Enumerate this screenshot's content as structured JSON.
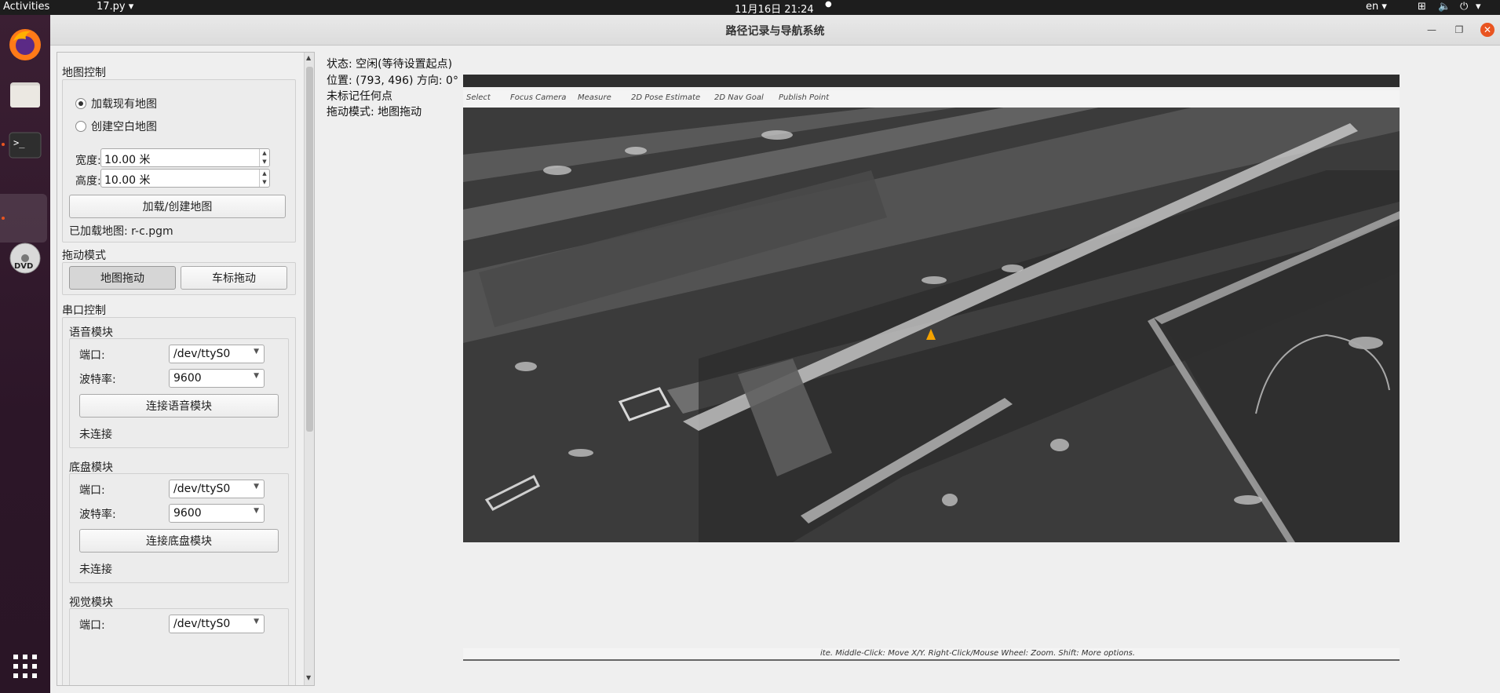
{
  "topbar": {
    "activities": "Activities",
    "app_menu": "17.py",
    "clock": "11月16日  21:24",
    "lang": "en"
  },
  "window": {
    "title": "路径记录与导航系统"
  },
  "map_control": {
    "section_label": "地图控制",
    "radio_load": "加载现有地图",
    "radio_create": "创建空白地图",
    "selected": "加载现有地图",
    "width_label": "宽度:",
    "width_value": "10.00 米",
    "height_label": "高度:",
    "height_value": "10.00 米",
    "load_button": "加载/创建地图",
    "loaded_text": "已加载地图: r-c.pgm"
  },
  "drag_mode": {
    "section_label": "拖动模式",
    "map_drag": "地图拖动",
    "marker_drag": "车标拖动"
  },
  "serial": {
    "section_label": "串口控制",
    "voice": {
      "title": "语音模块",
      "port_label": "端口:",
      "port_value": "/dev/ttyS0",
      "baud_label": "波特率:",
      "baud_value": "9600",
      "connect_button": "连接语音模块",
      "status": "未连接"
    },
    "chassis": {
      "title": "底盘模块",
      "port_label": "端口:",
      "port_value": "/dev/ttyS0",
      "baud_label": "波特率:",
      "baud_value": "9600",
      "connect_button": "连接底盘模块",
      "status": "未连接"
    },
    "vision": {
      "title": "视觉模块",
      "port_label": "端口:",
      "port_value": "/dev/ttyS0"
    }
  },
  "status": {
    "state": "状态: 空闲(等待设置起点)",
    "position": "位置: (793, 496) 方向: 0°",
    "marks": "未标记任何点",
    "drag": "拖动模式: 地图拖动"
  },
  "rviz": {
    "toolbar": [
      "Select",
      "Focus Camera",
      "Measure",
      "2D Pose Estimate",
      "2D Nav Goal",
      "Publish Point"
    ],
    "hint": "ite. Middle-Click: Move X/Y. Right-Click/Mouse Wheel: Zoom. Shift: More options."
  },
  "colors": {
    "accent": "#e95420",
    "marker": "#f5a300"
  }
}
